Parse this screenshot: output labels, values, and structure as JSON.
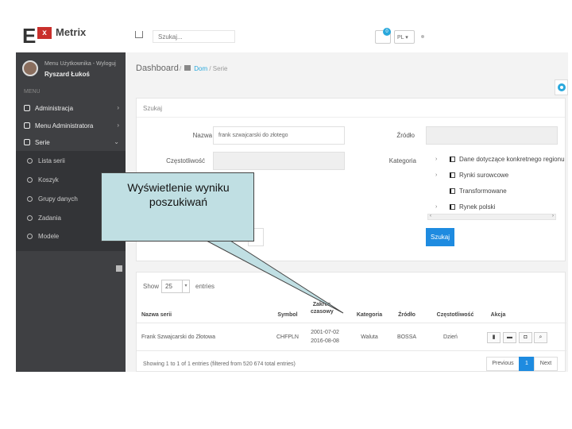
{
  "header": {
    "logo_letter": "E",
    "logo_badge": "x",
    "app_name": "Metrix",
    "search_placeholder": "Szukaj...",
    "cart_count": "0",
    "language": "PL"
  },
  "sidebar": {
    "user_welcome": "Menu Użytkownika - Wyloguj",
    "user_name": "Ryszard Łukoś",
    "menu_caption": "MENU",
    "items": [
      {
        "label": "Administracja"
      },
      {
        "label": "Menu Administratora"
      },
      {
        "label": "Serie"
      }
    ],
    "sub_items": [
      {
        "label": "Lista serii"
      },
      {
        "label": "Koszyk"
      },
      {
        "label": "Grupy danych"
      },
      {
        "label": "Zadania"
      },
      {
        "label": "Modele"
      }
    ]
  },
  "breadcrumb": {
    "title": "Dashboard",
    "home": "Dom",
    "current": "Serie"
  },
  "search": {
    "heading": "Szukaj",
    "name_label": "Nazwa serii",
    "name_value": "frank szwajcarski do złotego",
    "source_label": "Źródło",
    "frequency_label": "Częstotliwość",
    "category_label": "Kategoria",
    "categories": [
      {
        "label": "Dane dotyczące konkretnego regionu"
      },
      {
        "label": "Rynki surowcowe"
      },
      {
        "label": "Transformowane"
      },
      {
        "label": "Rynek polski"
      }
    ],
    "search_button": "Szukaj"
  },
  "results": {
    "show_label": "Show",
    "page_size": "25",
    "entries_label": "entries",
    "columns": [
      "Nazwa serii",
      "Symbol",
      "Zakres czasowy",
      "Kategoria",
      "Źródło",
      "Częstotliwość",
      "Akcja"
    ],
    "rows": [
      {
        "name": "Frank Szwajcarski do Złotowa",
        "symbol": "CHFPLN",
        "range_start": "2001-07-02",
        "range_end": "2016-08-08",
        "category": "Waluta",
        "source": "BOSSA",
        "frequency": "Dzień"
      }
    ],
    "info": "Showing 1 to 1 of 1 entries (filtered from 520 674 total entries)",
    "pagination": {
      "previous": "Previous",
      "page": "1",
      "next": "Next"
    }
  },
  "callout": {
    "text": "Wyświetlenie wyniku poszukiwań"
  }
}
